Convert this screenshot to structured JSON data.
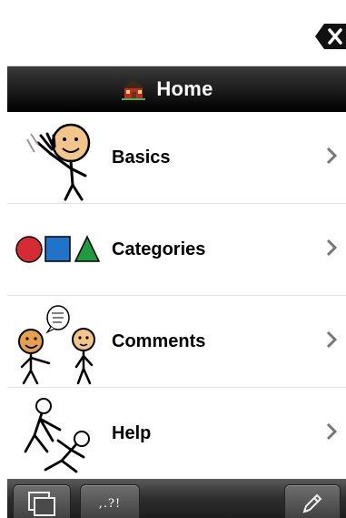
{
  "title_bar": {
    "title": "Home",
    "icon": "house-icon"
  },
  "message_bar": {
    "text": "",
    "clear_icon": "clear-delete-icon"
  },
  "list": {
    "items": [
      {
        "label": "Basics",
        "icon": "waving-person-icon"
      },
      {
        "label": "Categories",
        "icon": "shapes-icon"
      },
      {
        "label": "Comments",
        "icon": "talking-people-icon"
      },
      {
        "label": "Help",
        "icon": "helping-person-icon"
      }
    ]
  },
  "toolbar": {
    "windows_icon": "windows-icon",
    "punctuation_label": ",.?!",
    "edit_icon": "pencil-icon"
  },
  "colors": {
    "title_bar": "#1a1a1a",
    "circle": "#d62b35",
    "square": "#1f74c9",
    "triangle": "#1e9b3e"
  }
}
